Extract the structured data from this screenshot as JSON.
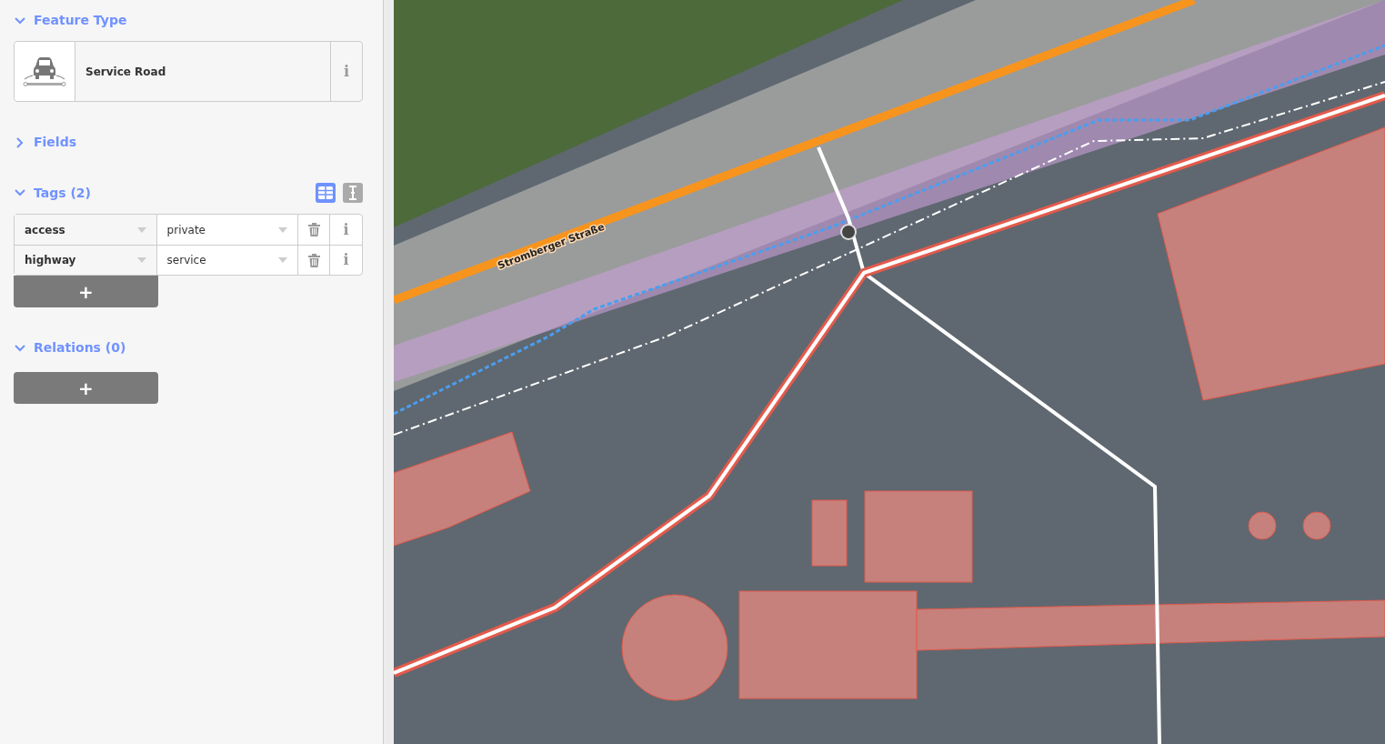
{
  "sections": [
    {
      "kind": "preset",
      "title": "Feature Type",
      "expanded": true,
      "preset": {
        "name": "Service Road",
        "info": "i"
      }
    },
    {
      "kind": "fields",
      "title": "Fields",
      "expanded": false
    },
    {
      "kind": "tags",
      "title": "Tags (2)",
      "expanded": true,
      "views": [
        {
          "kind": "table",
          "selected": true
        },
        {
          "kind": "text",
          "selected": false
        }
      ],
      "tags": [
        {
          "key": "access",
          "value": "private",
          "info": "i"
        },
        {
          "key": "highway",
          "value": "service",
          "info": "i"
        }
      ],
      "add": "+"
    },
    {
      "kind": "relations",
      "title": "Relations (0)",
      "expanded": true,
      "add": "+"
    }
  ],
  "map": {
    "road_label": "Stromberger Straße"
  }
}
